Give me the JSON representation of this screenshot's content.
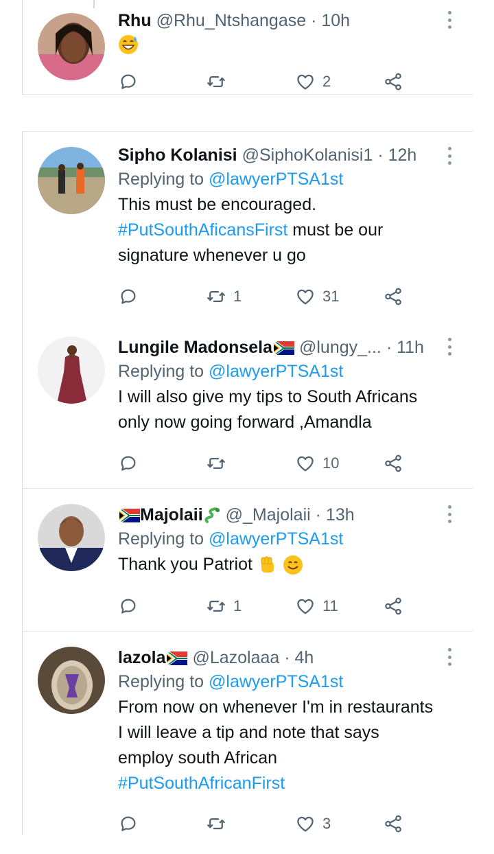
{
  "tweets": [
    {
      "name": "Rhu",
      "handle": "@Rhu_Ntshangase",
      "time": "10h",
      "retweets": "",
      "likes": "2",
      "avatar": "woman-portrait"
    },
    {
      "name": "Sipho Kolanisi",
      "handle": "@SiphoKolanisi1",
      "time": "12h",
      "replying_label": "Replying to",
      "replying_to": "@lawyerPTSA1st",
      "text_1": "This must be encouraged.",
      "hashtag": "#PutSouthAficansFirst",
      "text_2": " must be our",
      "text_3": "signature whenever u go",
      "retweets": "1",
      "likes": "31",
      "avatar": "outdoor-people"
    },
    {
      "name": "Lungile Madonsela",
      "handle": "@lungy_...",
      "time": "11h",
      "replying_label": "Replying to",
      "replying_to": "@lawyerPTSA1st",
      "text_1": "I will also give my tips to South Africans",
      "text_2": "only now going forward ,Amandla",
      "retweets": "",
      "likes": "10",
      "avatar": "woman-in-red-dress"
    },
    {
      "name": "Majolaii",
      "handle": "@_Majolaii",
      "time": "13h",
      "replying_label": "Replying to",
      "replying_to": "@lawyerPTSA1st",
      "text_1": "Thank you Patriot",
      "retweets": "1",
      "likes": "11",
      "avatar": "man-portrait"
    },
    {
      "name": "lazola",
      "handle": "@Lazolaaa",
      "time": "4h",
      "replying_label": "Replying to",
      "replying_to": "@lawyerPTSA1st",
      "text_1": "From now on whenever I'm in restaurants",
      "text_2": "I will leave a tip and note that says",
      "text_3": "employ south African",
      "hashtag": "#PutSouthAfricanFirst",
      "retweets": "",
      "likes": "3",
      "avatar": "drink-with-logo"
    }
  ],
  "icons": {
    "reply": "reply-icon",
    "retweet": "retweet-icon",
    "like": "heart-icon",
    "share": "share-icon",
    "more": "more-options-icon"
  },
  "colors": {
    "link": "#1d9bf0",
    "muted": "#536471",
    "text": "#0f1419",
    "divider": "#e3e7ea"
  }
}
